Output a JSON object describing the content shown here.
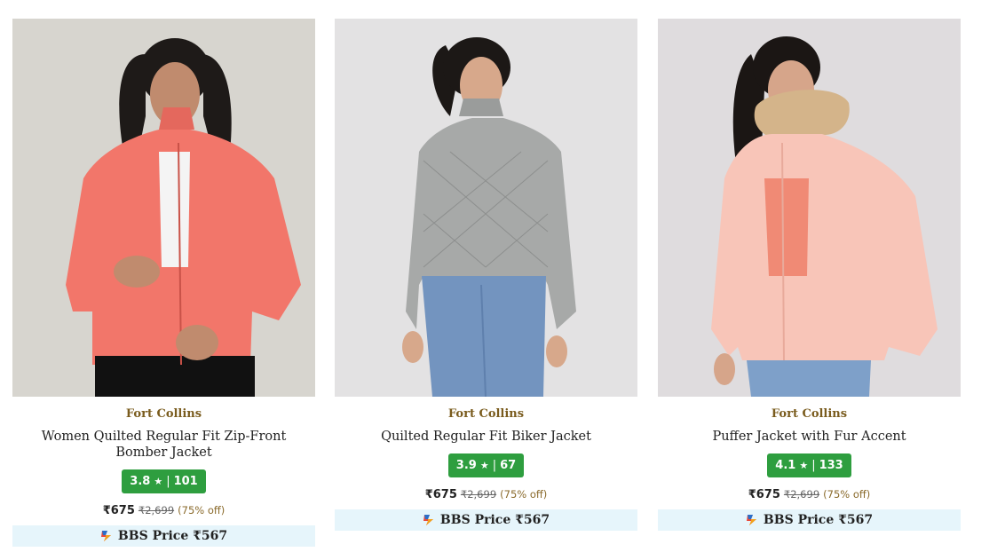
{
  "products": [
    {
      "brand": "Fort Collins",
      "title": "Women Quilted Regular Fit Zip-Front Bomber Jacket",
      "rating": "3.8",
      "rating_count": "101",
      "price": "₹675",
      "mrp": "₹2,699",
      "discount": "(75% off)",
      "bbs_label": "BBS Price ₹567",
      "jacket_color": "#f2766a",
      "bg_color": "#d7d5cf"
    },
    {
      "brand": "Fort Collins",
      "title": "Quilted Regular Fit Biker Jacket",
      "rating": "3.9",
      "rating_count": "67",
      "price": "₹675",
      "mrp": "₹2,699",
      "discount": "(75% off)",
      "bbs_label": "BBS Price ₹567",
      "jacket_color": "#a7a9a8",
      "bg_color": "#e3e2e3"
    },
    {
      "brand": "Fort Collins",
      "title": "Puffer Jacket with Fur Accent",
      "rating": "4.1",
      "rating_count": "133",
      "price": "₹675",
      "mrp": "₹2,699",
      "discount": "(75% off)",
      "bbs_label": "BBS Price ₹567",
      "jacket_color": "#f8c5b8",
      "bg_color": "#dfdcde"
    }
  ],
  "colors": {
    "rating_badge": "#2e9e3f",
    "brand_text": "#7a5c1e",
    "bbs_bg": "#e6f5fb"
  },
  "icons": {
    "rating": "star-icon",
    "bbs": "bbs-badge-icon"
  }
}
